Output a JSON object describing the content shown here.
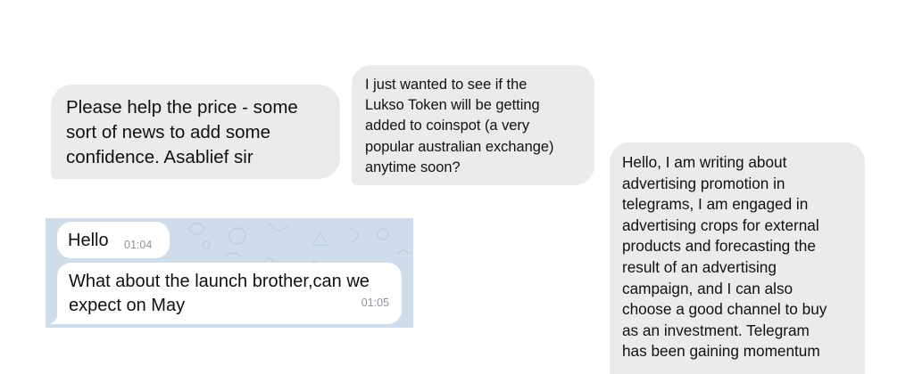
{
  "bubbles": [
    {
      "text": "Please help the price - some\nsort of news to add some\nconfidence. Asablief sir"
    },
    {
      "text": "I just wanted to see if the\nLukso Token will be getting\nadded to coinspot (a very\npopular australian exchange)\nanytime soon?"
    },
    {
      "text": "Hello, I am writing about\nadvertising promotion in\ntelegrams, I am engaged in\nadvertising crops for external\nproducts and forecasting the\nresult of an advertising\ncampaign, and I can also\nchoose a good channel to buy\nas an investment. Telegram\nhas been gaining momentum"
    }
  ],
  "telegram": {
    "messages": [
      {
        "text": "Hello",
        "time": "01:04"
      },
      {
        "text": "What about the launch brother,can we\nexpect on May",
        "time": "01:05"
      }
    ],
    "colors": {
      "background": "#cfdcea",
      "bubble": "#ffffff",
      "timestamp": "#8d959c"
    }
  },
  "colors": {
    "page_background": "#ffffff",
    "bubble_gray": "#ebebed"
  }
}
